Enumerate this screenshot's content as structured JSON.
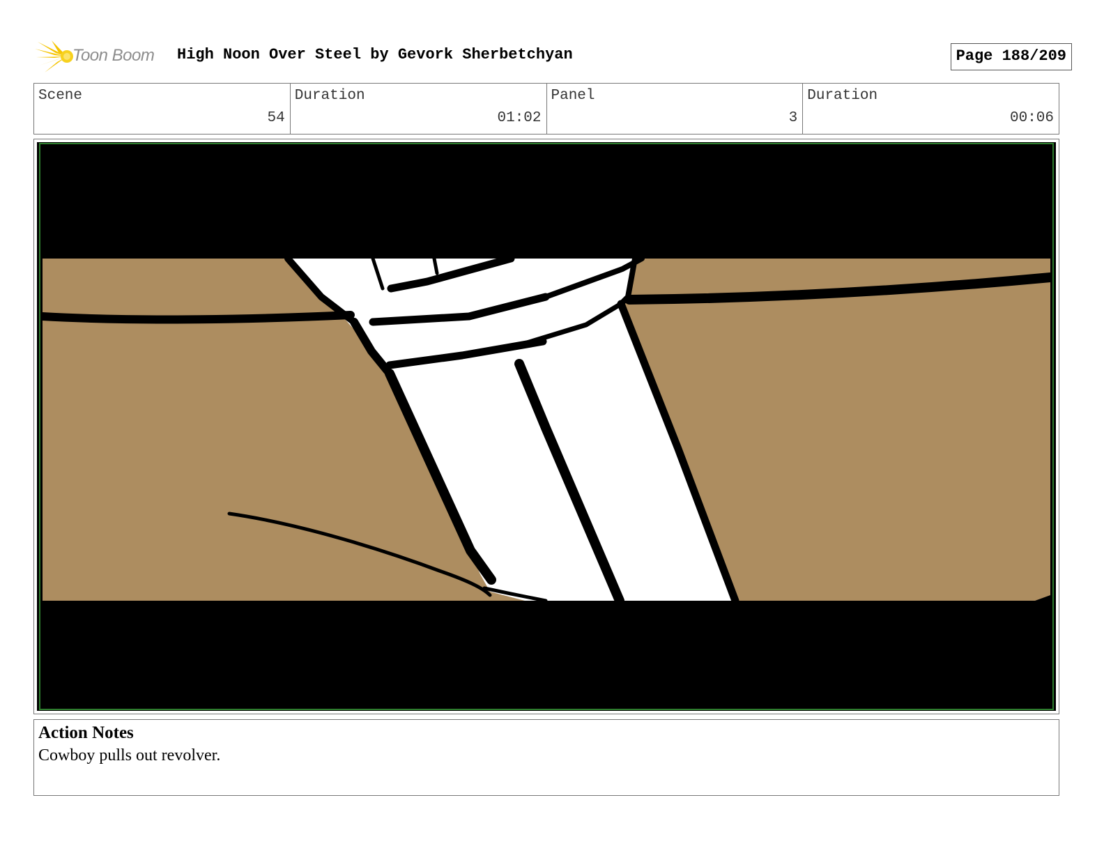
{
  "header": {
    "logo_text": "Toon Boom",
    "title": "High Noon Over Steel by Gevork Sherbetchyan",
    "page_label": "Page 188/209"
  },
  "info": {
    "scene_label": "Scene",
    "scene_value": "54",
    "scene_duration_label": "Duration",
    "scene_duration_value": "01:02",
    "panel_label": "Panel",
    "panel_value": "3",
    "panel_duration_label": "Duration",
    "panel_duration_value": "00:06"
  },
  "panel_image": {
    "icon": "storyboard-drawing",
    "colors": {
      "letterbox": "#000000",
      "background": "#ad8d60",
      "holster": "#ffffff",
      "ink": "#000000",
      "frame": "#2e7d2e"
    }
  },
  "notes": {
    "heading": "Action Notes",
    "text": "Cowboy pulls out revolver."
  }
}
